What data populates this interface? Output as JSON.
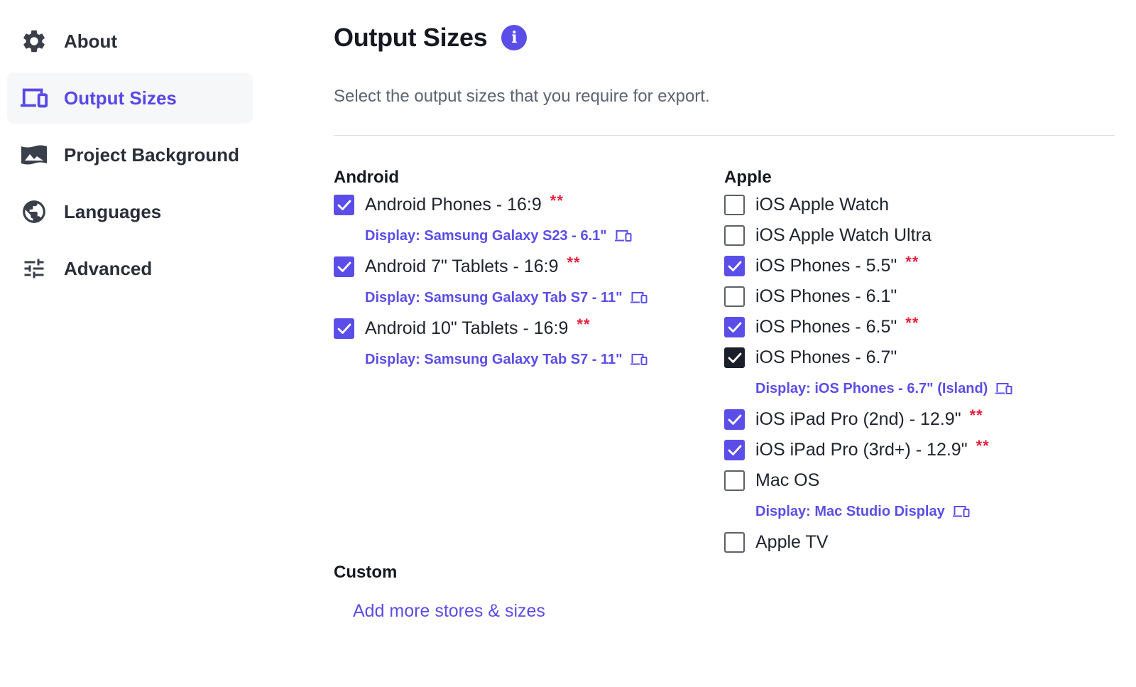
{
  "sidebar": {
    "items": [
      {
        "label": "About",
        "icon": "gear-icon"
      },
      {
        "label": "Output Sizes",
        "icon": "devices-icon",
        "active": true
      },
      {
        "label": "Project Background",
        "icon": "image-icon"
      },
      {
        "label": "Languages",
        "icon": "globe-icon"
      },
      {
        "label": "Advanced",
        "icon": "sliders-icon"
      }
    ]
  },
  "main": {
    "title": "Output Sizes",
    "info_glyph": "i",
    "subtitle": "Select the output sizes that you require for export.",
    "android": {
      "heading": "Android",
      "options": [
        {
          "label": "Android Phones - 16:9",
          "checked": true,
          "required": "**",
          "display": "Display: Samsung Galaxy S23 - 6.1\""
        },
        {
          "label": "Android 7\" Tablets - 16:9",
          "checked": true,
          "required": "**",
          "display": "Display: Samsung Galaxy Tab S7 - 11\""
        },
        {
          "label": "Android 10\" Tablets - 16:9",
          "checked": true,
          "required": "**",
          "display": "Display: Samsung Galaxy Tab S7 - 11\""
        }
      ]
    },
    "apple": {
      "heading": "Apple",
      "options": [
        {
          "label": "iOS Apple Watch",
          "checked": false
        },
        {
          "label": "iOS Apple Watch Ultra",
          "checked": false
        },
        {
          "label": "iOS Phones - 5.5\"",
          "checked": true,
          "required": "**"
        },
        {
          "label": "iOS Phones - 6.1\"",
          "checked": false
        },
        {
          "label": "iOS Phones - 6.5\"",
          "checked": true,
          "required": "**"
        },
        {
          "label": "iOS Phones - 6.7\"",
          "checked": true,
          "focused": true,
          "display": "Display: iOS Phones - 6.7\" (Island)"
        },
        {
          "label": "iOS iPad Pro (2nd) - 12.9\"",
          "checked": true,
          "required": "**"
        },
        {
          "label": "iOS iPad Pro (3rd+) - 12.9\"",
          "checked": true,
          "required": "**"
        },
        {
          "label": "Mac OS",
          "checked": false,
          "display": "Display: Mac Studio Display"
        },
        {
          "label": "Apple TV",
          "checked": false
        }
      ]
    },
    "custom": {
      "heading": "Custom",
      "link": "Add more stores & sizes"
    }
  },
  "colors": {
    "accent": "#5b4ee8",
    "required": "#e81e3c",
    "text": "#20242e",
    "muted": "#5c6372"
  }
}
